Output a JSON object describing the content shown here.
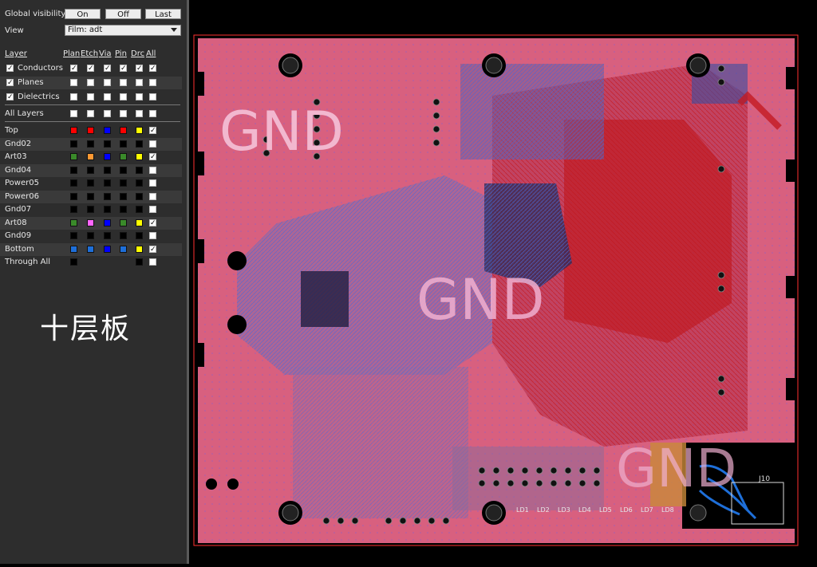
{
  "panel": {
    "global_visibility_label": "Global visibility",
    "buttons": {
      "on": "On",
      "off": "Off",
      "last": "Last"
    },
    "view_label": "View",
    "view_value": "Film: adt",
    "columns": [
      "Layer",
      "Plan",
      "Etch",
      "Via",
      "Pin",
      "Drc",
      "All"
    ],
    "groups": [
      {
        "label": "Conductors",
        "checked": true
      },
      {
        "label": "Planes",
        "checked": true
      },
      {
        "label": "Dielectrics",
        "checked": true
      }
    ],
    "all_layers_label": "All Layers",
    "layers": [
      {
        "name": "Top",
        "colors": [
          "#ff0000",
          "#ff0000",
          "#0000ff",
          "#ff0000",
          "#ffff00"
        ],
        "all": true
      },
      {
        "name": "Gnd02",
        "colors": [
          "#000000",
          "#000000",
          "#000000",
          "#000000",
          "#000000"
        ],
        "all": false
      },
      {
        "name": "Art03",
        "colors": [
          "#3a8a2a",
          "#ff9933",
          "#0000ff",
          "#3a8a2a",
          "#ffff00"
        ],
        "all": true
      },
      {
        "name": "Gnd04",
        "colors": [
          "#000000",
          "#000000",
          "#000000",
          "#000000",
          "#000000"
        ],
        "all": false
      },
      {
        "name": "Power05",
        "colors": [
          "#000000",
          "#000000",
          "#000000",
          "#000000",
          "#000000"
        ],
        "all": false
      },
      {
        "name": "Power06",
        "colors": [
          "#000000",
          "#000000",
          "#000000",
          "#000000",
          "#000000"
        ],
        "all": false
      },
      {
        "name": "Gnd07",
        "colors": [
          "#000000",
          "#000000",
          "#000000",
          "#000000",
          "#000000"
        ],
        "all": false
      },
      {
        "name": "Art08",
        "colors": [
          "#3a8a2a",
          "#ff66ff",
          "#0000ff",
          "#3a8a2a",
          "#ffff00"
        ],
        "all": true
      },
      {
        "name": "Gnd09",
        "colors": [
          "#000000",
          "#000000",
          "#000000",
          "#000000",
          "#000000"
        ],
        "all": false
      },
      {
        "name": "Bottom",
        "colors": [
          "#1e6fd9",
          "#1e6fd9",
          "#0000ff",
          "#1e6fd9",
          "#ffff00"
        ],
        "all": true
      },
      {
        "name": "Through All",
        "colors": [
          "#000000",
          null,
          null,
          null,
          "#000000"
        ],
        "all": false
      }
    ],
    "caption": "十层板"
  },
  "board": {
    "gnd_labels": [
      "GND",
      "GND",
      "GND"
    ],
    "connector_label": "J10",
    "led_labels": [
      "LD1",
      "LD2",
      "LD3",
      "LD4",
      "LD5",
      "LD6",
      "LD7",
      "LD8"
    ],
    "colors": {
      "plane": "#d8607f",
      "trace_red": "#c41a22",
      "trace_blue": "#4a6ad8",
      "outline": "#ff3030"
    }
  }
}
